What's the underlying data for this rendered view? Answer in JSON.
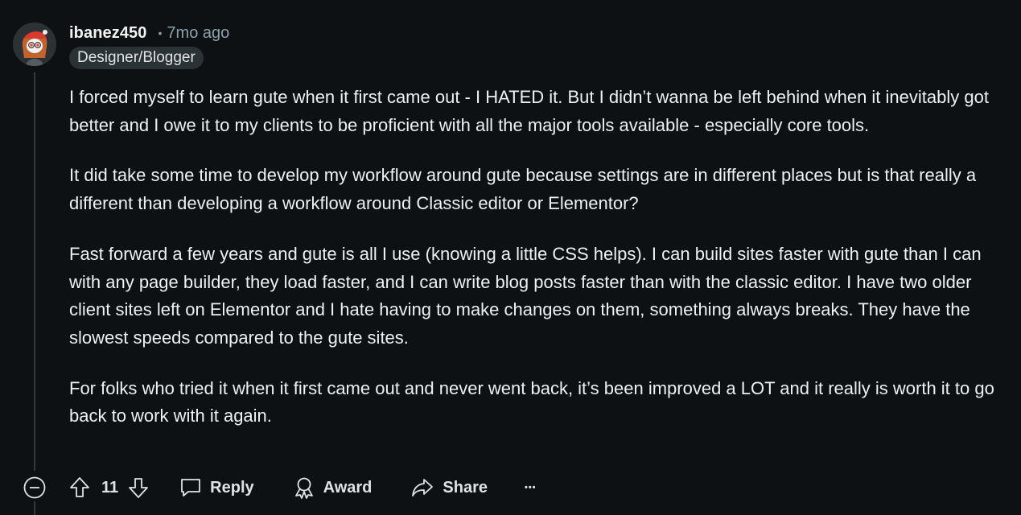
{
  "comment": {
    "author": "ibanez450",
    "separator": "•",
    "time_ago": "7mo ago",
    "flair": "Designer/Blogger",
    "paragraphs": [
      "I forced myself to learn gute when it first came out - I HATED it. But I didn’t wanna be left behind when it inevitably got better and I owe it to my clients to be proficient with all the major tools available - especially core tools.",
      "It did take some time to develop my workflow around gute because settings are in different places but is that really a different than developing a workflow around Classic editor or Elementor?",
      "Fast forward a few years and gute is all I use (knowing a little CSS helps). I can build sites faster with gute than I can with any page builder, they load faster, and I can write blog posts faster than with the classic editor. I have two older client sites left on Elementor and I hate having to make changes on them, something always breaks. They have the slowest speeds compared to the gute sites.",
      "For folks who tried it when it first came out and never went back, it’s been improved a LOT and it really is worth it to go back to work with it again."
    ]
  },
  "actions": {
    "score": "11",
    "reply_label": "Reply",
    "award_label": "Award",
    "share_label": "Share",
    "more_label": "•••"
  },
  "icons": {
    "collapse": "collapse-minus-icon",
    "upvote": "upvote-arrow-icon",
    "downvote": "downvote-arrow-icon",
    "reply": "speech-bubble-icon",
    "award": "award-ribbon-icon",
    "share": "share-arrow-icon"
  },
  "colors": {
    "background": "#0e1113",
    "text": "#eef1f3",
    "muted": "#8ba2ad",
    "flair_bg": "#2a3236"
  }
}
